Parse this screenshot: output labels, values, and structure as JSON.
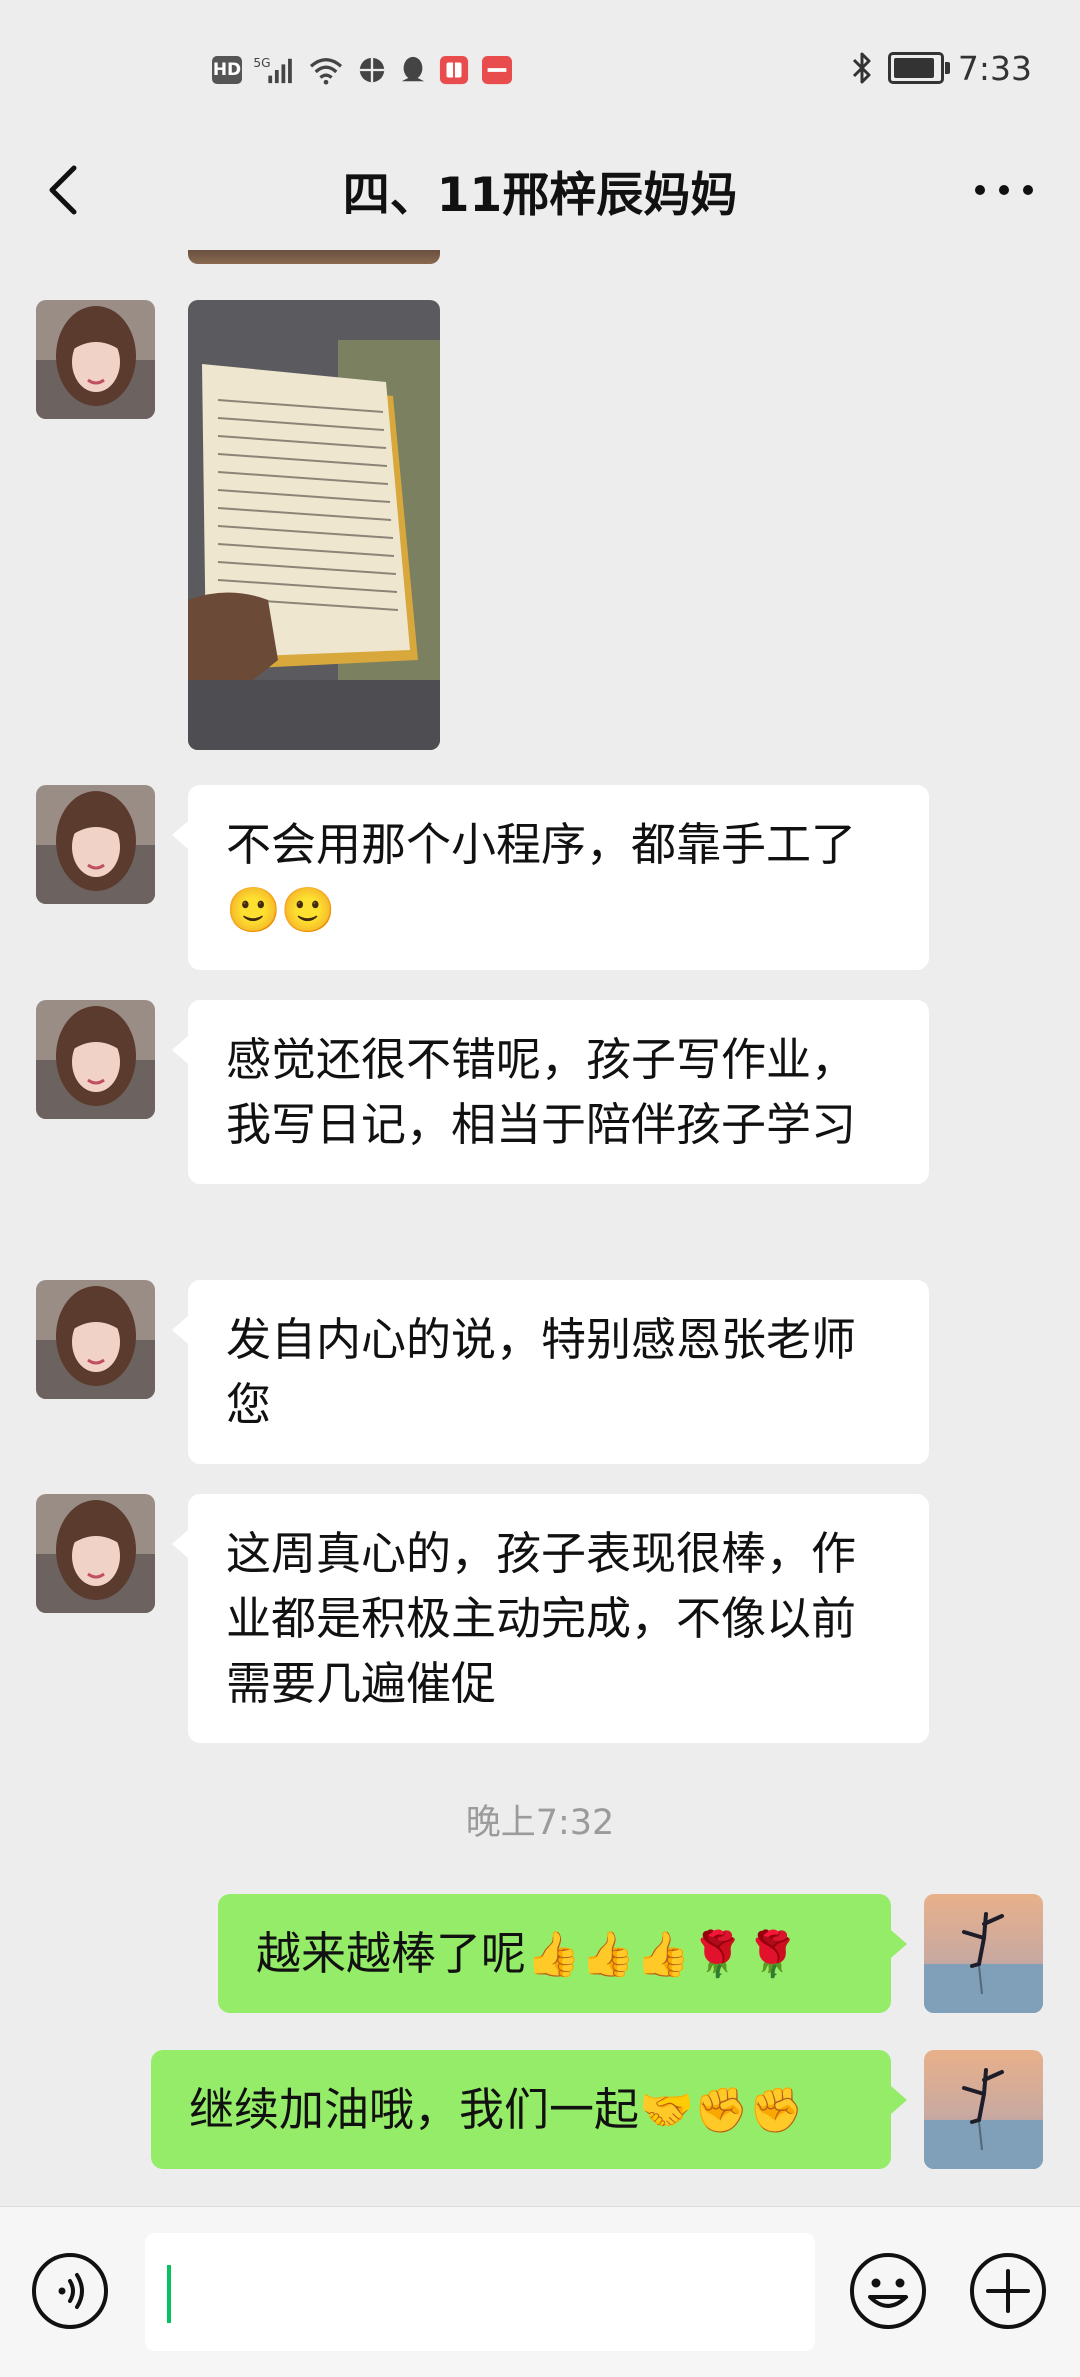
{
  "status_bar": {
    "time": "7:33",
    "hd_badge": "HD",
    "network": "5G",
    "icons": [
      "hd-icon",
      "signal-5g-icon",
      "wifi-icon",
      "vpn-icon",
      "qq-icon",
      "book-app-icon",
      "huawei-app-icon",
      "bluetooth-icon",
      "battery-icon"
    ]
  },
  "header": {
    "title": "四、11邢梓辰妈妈",
    "back_icon": "chevron-left-icon",
    "more_icon": "more-dots-icon"
  },
  "messages": [
    {
      "side": "left",
      "type": "image",
      "content": "photo-of-handwritten-notebook"
    },
    {
      "side": "left",
      "type": "text",
      "text": "不会用那个小程序，都靠手工了",
      "emoji": "🙂🙂"
    },
    {
      "side": "left",
      "type": "text",
      "text": "感觉还很不错呢，孩子写作业，我写日记，相当于陪伴孩子学习"
    },
    {
      "side": "left",
      "type": "text",
      "text": "发自内心的说，特别感恩张老师您"
    },
    {
      "side": "left",
      "type": "text",
      "text": "这周真心的，孩子表现很棒，作业都是积极主动完成，不像以前需要几遍催促"
    }
  ],
  "timestamp": "晚上7:32",
  "my_messages": [
    {
      "side": "right",
      "type": "text",
      "text": "越来越棒了呢",
      "emoji": "👍👍👍🌹🌹"
    },
    {
      "side": "right",
      "type": "text",
      "text": "继续加油哦，我们一起",
      "emoji": "🤝✊✊"
    }
  ],
  "input_bar": {
    "voice_icon": "voice-icon",
    "emoji_icon": "smiley-icon",
    "plus_icon": "plus-circle-icon",
    "value": ""
  },
  "colors": {
    "background": "#ededed",
    "my_bubble": "#95ec69",
    "their_bubble": "#ffffff",
    "caret": "#07c160"
  }
}
